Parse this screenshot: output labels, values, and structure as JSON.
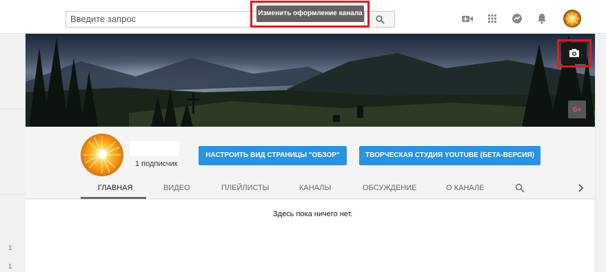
{
  "header": {
    "search": {
      "placeholder": "Введите запрос"
    },
    "tooltip": "Изменить оформление канала",
    "icons": [
      "search-icon",
      "video-camera-icon",
      "apps-grid-icon",
      "messages-icon",
      "notifications-bell-icon",
      "account-avatar-icon"
    ]
  },
  "banner": {
    "icons": [
      "camera-icon",
      "google-plus-icon"
    ],
    "gplus_label": "G+"
  },
  "channel": {
    "subscribers": "1 подписчик",
    "buttons": {
      "customize": "НАСТРОИТЬ ВИД СТРАНИЦЫ \"ОБЗОР\"",
      "studio": "ТВОРЧЕСКАЯ СТУДИЯ YOUTUBE (БЕТА-ВЕРСИЯ)"
    },
    "tabs": [
      "ГЛАВНАЯ",
      "ВИДЕО",
      "ПЛЕЙЛИСТЫ",
      "КАНАЛЫ",
      "ОБСУЖДЕНИЕ",
      "О КАНАЛЕ"
    ],
    "active_tab": "ГЛАВНАЯ"
  },
  "content": {
    "empty_message": "Здесь пока ничего нет."
  },
  "left_gutter": {
    "numbers": [
      "1",
      "1"
    ]
  },
  "colors": {
    "accent_button": "#2793e6",
    "highlight_frame": "#e2191b",
    "tooltip_bg": "#616161"
  }
}
